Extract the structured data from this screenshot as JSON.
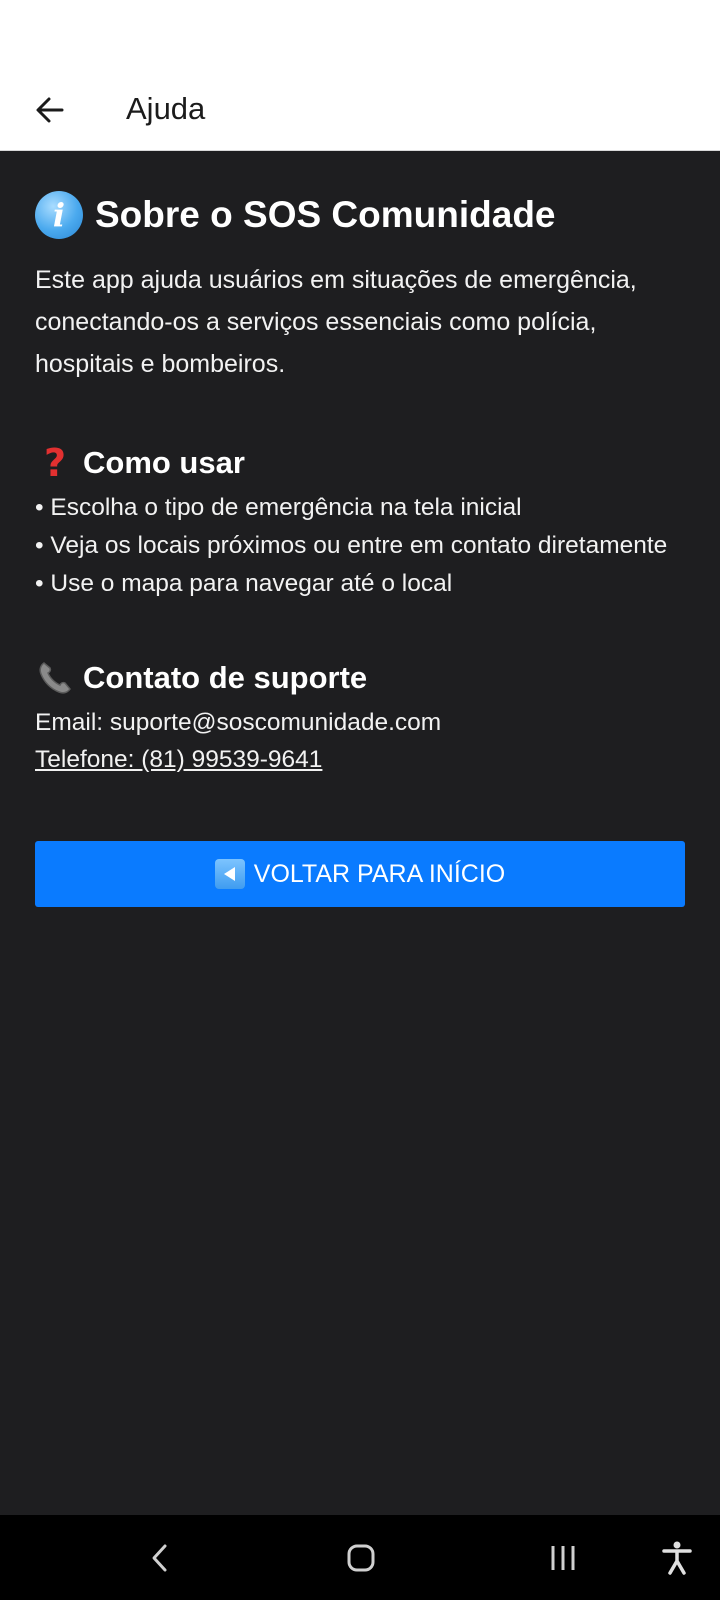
{
  "app_bar": {
    "title": "Ajuda",
    "back_icon": "arrow-left-icon"
  },
  "about": {
    "icon": "info-icon",
    "title": "Sobre o SOS Comunidade",
    "description": "Este app ajuda usuários em situações de emergência, conectando-os a serviços essenciais como polícia, hospitais e bombeiros."
  },
  "how_to": {
    "icon": "question-mark-icon",
    "title": "Como usar",
    "items": [
      "• Escolha o tipo de emergência na tela inicial",
      "• Veja os locais próximos ou entre em contato diretamente",
      "• Use o mapa para navegar até o local"
    ]
  },
  "support": {
    "icon": "telephone-icon",
    "title": "Contato de suporte",
    "email": "Email: suporte@soscomunidade.com",
    "phone": "Telefone: (81) 99539-9641"
  },
  "home_button": {
    "icon": "reverse-button-icon",
    "label": "VOLTAR PARA INÍCIO"
  },
  "colors": {
    "background": "#1e1e20",
    "primary": "#0a7bff",
    "app_bar": "#ffffff"
  },
  "system_nav": {
    "buttons": [
      "back-icon",
      "home-icon",
      "recents-icon",
      "accessibility-icon"
    ]
  }
}
